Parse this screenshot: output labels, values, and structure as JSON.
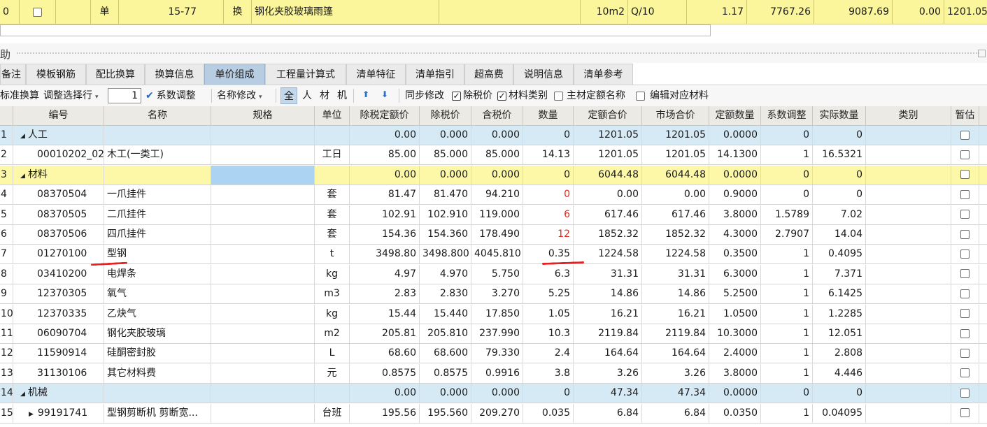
{
  "top_row": {
    "index": "0",
    "type": "单",
    "code": "15-77",
    "flag": "换",
    "name": "钢化夹胶玻璃雨篷",
    "unit": "10m2",
    "qty_expr": "Q/10",
    "quantity": "1.17",
    "price1": "7767.26",
    "price2": "9087.69",
    "price3": "0.00",
    "price4": "1201.05"
  },
  "panel": {
    "title": "助"
  },
  "tabs": [
    "备注",
    "模板钢筋",
    "配比换算",
    "换算信息",
    "单价组成",
    "工程量计算式",
    "清单特征",
    "清单指引",
    "超高费",
    "说明信息",
    "清单参考"
  ],
  "active_tab": "单价组成",
  "toolbar": {
    "std_convert": "标准换算",
    "adjust_row": "调整选择行",
    "spin_value": "1",
    "coef_adjust": "系数调整",
    "name_modify": "名称修改",
    "filter_all": "全",
    "filter_labor": "人",
    "filter_material": "材",
    "filter_machine": "机",
    "sync_modify": "同步修改",
    "excl_tax_price": "除税价",
    "material_category": "材料类别",
    "main_material_name": "主材定额名称",
    "edit_material": "编辑对应材料"
  },
  "columns": [
    "编号",
    "名称",
    "规格",
    "单位",
    "除税定额价",
    "除税价",
    "含税价",
    "数量",
    "定额合价",
    "市场合价",
    "定额数量",
    "系数调整",
    "实际数量",
    "类别",
    "暂估"
  ],
  "rows": [
    {
      "n": "1",
      "code": "",
      "name": "人工",
      "spec": "",
      "unit": "",
      "p1": "0.00",
      "p2": "0.000",
      "p3": "0.000",
      "qty": "0",
      "sum1": "1201.05",
      "sum2": "1201.05",
      "dq": "0.0000",
      "coef": "0",
      "aq": "0",
      "kind": "group-blue",
      "group": true,
      "red": false
    },
    {
      "n": "2",
      "code": "00010202_02",
      "name": "木工(一类工)",
      "spec": "",
      "unit": "工日",
      "p1": "85.00",
      "p2": "85.000",
      "p3": "85.000",
      "qty": "14.13",
      "sum1": "1201.05",
      "sum2": "1201.05",
      "dq": "14.1300",
      "coef": "1",
      "aq": "16.5321",
      "kind": "normal",
      "group": false,
      "red": false
    },
    {
      "n": "3",
      "code": "",
      "name": "材料",
      "spec": "",
      "unit": "",
      "p1": "0.00",
      "p2": "0.000",
      "p3": "0.000",
      "qty": "0",
      "sum1": "6044.48",
      "sum2": "6044.48",
      "dq": "0.0000",
      "coef": "0",
      "aq": "0",
      "kind": "group-yellow",
      "group": true,
      "red": false
    },
    {
      "n": "4",
      "code": "08370504",
      "name": "一爪挂件",
      "spec": "",
      "unit": "套",
      "p1": "81.47",
      "p2": "81.470",
      "p3": "94.210",
      "qty": "0",
      "sum1": "0.00",
      "sum2": "0.00",
      "dq": "0.9000",
      "coef": "0",
      "aq": "0",
      "kind": "normal",
      "group": false,
      "red": true
    },
    {
      "n": "5",
      "code": "08370505",
      "name": "二爪挂件",
      "spec": "",
      "unit": "套",
      "p1": "102.91",
      "p2": "102.910",
      "p3": "119.000",
      "qty": "6",
      "sum1": "617.46",
      "sum2": "617.46",
      "dq": "3.8000",
      "coef": "1.5789",
      "aq": "7.02",
      "kind": "normal",
      "group": false,
      "red": true
    },
    {
      "n": "6",
      "code": "08370506",
      "name": "四爪挂件",
      "spec": "",
      "unit": "套",
      "p1": "154.36",
      "p2": "154.360",
      "p3": "178.490",
      "qty": "12",
      "sum1": "1852.32",
      "sum2": "1852.32",
      "dq": "4.3000",
      "coef": "2.7907",
      "aq": "14.04",
      "kind": "normal",
      "group": false,
      "red": true
    },
    {
      "n": "7",
      "code": "01270100",
      "name": "型钢",
      "spec": "",
      "unit": "t",
      "p1": "3498.80",
      "p2": "3498.800",
      "p3": "4045.810",
      "qty": "0.35",
      "sum1": "1224.58",
      "sum2": "1224.58",
      "dq": "0.3500",
      "coef": "1",
      "aq": "0.4095",
      "kind": "normal",
      "group": false,
      "red": false
    },
    {
      "n": "8",
      "code": "03410200",
      "name": "电焊条",
      "spec": "",
      "unit": "kg",
      "p1": "4.97",
      "p2": "4.970",
      "p3": "5.750",
      "qty": "6.3",
      "sum1": "31.31",
      "sum2": "31.31",
      "dq": "6.3000",
      "coef": "1",
      "aq": "7.371",
      "kind": "normal",
      "group": false,
      "red": false
    },
    {
      "n": "9",
      "code": "12370305",
      "name": "氧气",
      "spec": "",
      "unit": "m3",
      "p1": "2.83",
      "p2": "2.830",
      "p3": "3.270",
      "qty": "5.25",
      "sum1": "14.86",
      "sum2": "14.86",
      "dq": "5.2500",
      "coef": "1",
      "aq": "6.1425",
      "kind": "normal",
      "group": false,
      "red": false
    },
    {
      "n": "10",
      "code": "12370335",
      "name": "乙炔气",
      "spec": "",
      "unit": "kg",
      "p1": "15.44",
      "p2": "15.440",
      "p3": "17.850",
      "qty": "1.05",
      "sum1": "16.21",
      "sum2": "16.21",
      "dq": "1.0500",
      "coef": "1",
      "aq": "1.2285",
      "kind": "normal",
      "group": false,
      "red": false
    },
    {
      "n": "11",
      "code": "06090704",
      "name": "钢化夹胶玻璃",
      "spec": "",
      "unit": "m2",
      "p1": "205.81",
      "p2": "205.810",
      "p3": "237.990",
      "qty": "10.3",
      "sum1": "2119.84",
      "sum2": "2119.84",
      "dq": "10.3000",
      "coef": "1",
      "aq": "12.051",
      "kind": "normal",
      "group": false,
      "red": false
    },
    {
      "n": "12",
      "code": "11590914",
      "name": "硅酮密封胶",
      "spec": "",
      "unit": "L",
      "p1": "68.60",
      "p2": "68.600",
      "p3": "79.330",
      "qty": "2.4",
      "sum1": "164.64",
      "sum2": "164.64",
      "dq": "2.4000",
      "coef": "1",
      "aq": "2.808",
      "kind": "normal",
      "group": false,
      "red": false
    },
    {
      "n": "13",
      "code": "31130106",
      "name": "其它材料费",
      "spec": "",
      "unit": "元",
      "p1": "0.8575",
      "p2": "0.8575",
      "p3": "0.9916",
      "qty": "3.8",
      "sum1": "3.26",
      "sum2": "3.26",
      "dq": "3.8000",
      "coef": "1",
      "aq": "4.446",
      "kind": "normal",
      "group": false,
      "red": false
    },
    {
      "n": "14",
      "code": "",
      "name": "机械",
      "spec": "",
      "unit": "",
      "p1": "0.00",
      "p2": "0.000",
      "p3": "0.000",
      "qty": "0",
      "sum1": "47.34",
      "sum2": "47.34",
      "dq": "0.0000",
      "coef": "0",
      "aq": "0",
      "kind": "group-blue",
      "group": true,
      "red": false
    },
    {
      "n": "15",
      "code": "99191741",
      "name": "型钢剪断机 剪断宽...",
      "spec": "",
      "unit": "台班",
      "p1": "195.56",
      "p2": "195.560",
      "p3": "209.270",
      "qty": "0.035",
      "sum1": "6.84",
      "sum2": "6.84",
      "dq": "0.0350",
      "coef": "1",
      "aq": "0.04095",
      "kind": "normal",
      "group": false,
      "red": false,
      "expand": true
    }
  ]
}
